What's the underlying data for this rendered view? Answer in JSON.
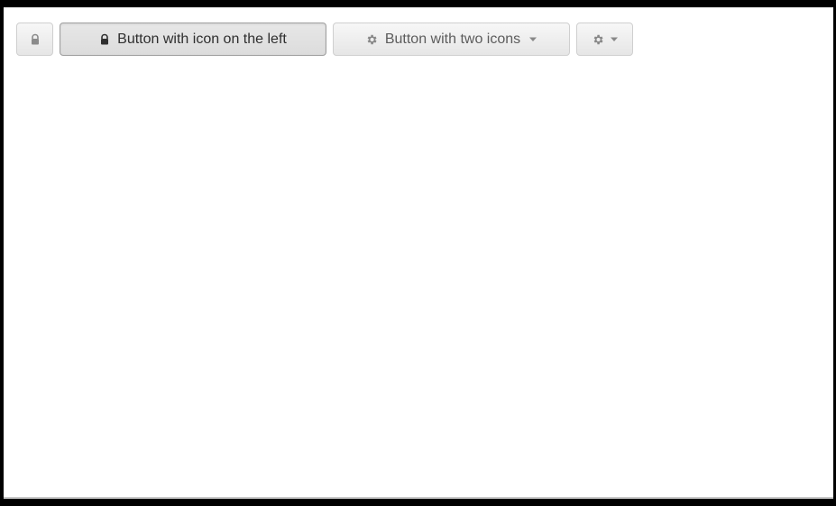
{
  "toolbar": {
    "buttons": [
      {
        "label": "",
        "icon": "lock-icon"
      },
      {
        "label": "Button with icon on the left",
        "icon": "lock-icon"
      },
      {
        "label": "Button with two icons",
        "left_icon": "gear-icon",
        "right_icon": "chevron-down-icon"
      },
      {
        "label": "",
        "left_icon": "gear-icon",
        "right_icon": "chevron-down-icon"
      }
    ]
  },
  "colors": {
    "outer_border": "#000000",
    "background": "#ffffff",
    "button_bg_top": "#f7f7f7",
    "button_bg_bottom": "#e6e6e6",
    "button_border": "#cfcfcf",
    "pressed_border": "#9e9e9e",
    "text": "#333333",
    "muted_icon": "#888888"
  }
}
